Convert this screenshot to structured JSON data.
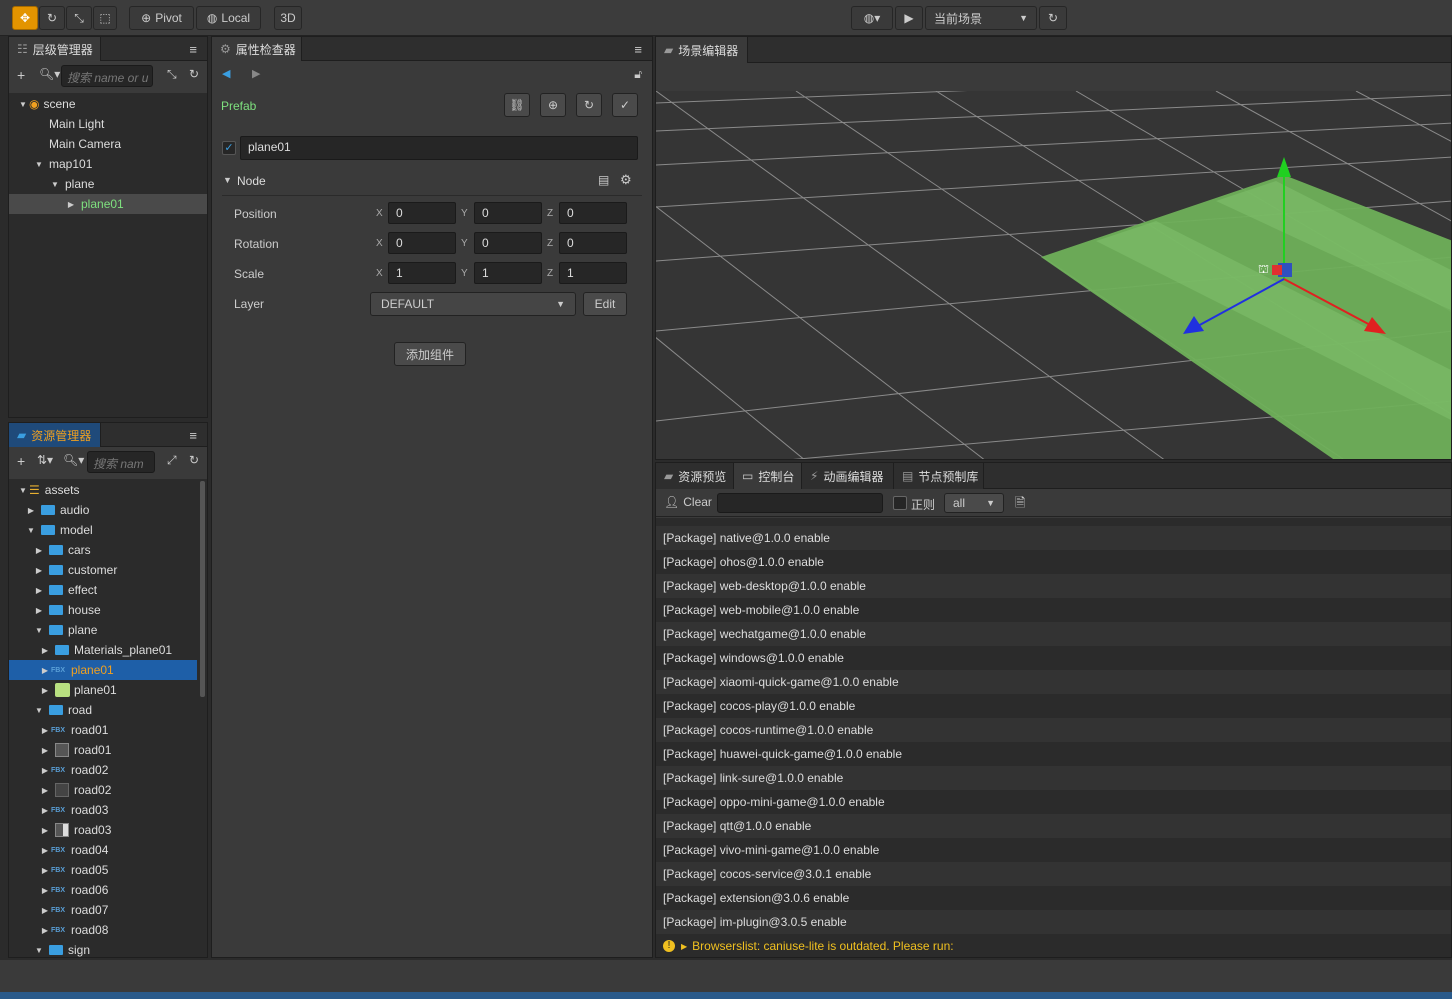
{
  "toolbar": {
    "pivot_label": "Pivot",
    "local_label": "Local",
    "mode_label": "3D",
    "scene_select": "当前场景"
  },
  "hierarchy": {
    "title": "层级管理器",
    "search_placeholder": "搜索 name or u",
    "nodes": [
      {
        "label": "scene",
        "depth": 0
      },
      {
        "label": "Main Light",
        "depth": 1
      },
      {
        "label": "Main Camera",
        "depth": 1
      },
      {
        "label": "map101",
        "depth": 1
      },
      {
        "label": "plane",
        "depth": 2
      },
      {
        "label": "plane01",
        "depth": 3,
        "selected": true
      }
    ]
  },
  "assets": {
    "title": "资源管理器",
    "search_placeholder": "搜索 nam",
    "items": [
      {
        "label": "assets",
        "type": "db"
      },
      {
        "label": "audio",
        "type": "folder"
      },
      {
        "label": "model",
        "type": "folder"
      },
      {
        "label": "cars",
        "type": "folder"
      },
      {
        "label": "customer",
        "type": "folder"
      },
      {
        "label": "effect",
        "type": "folder"
      },
      {
        "label": "house",
        "type": "folder"
      },
      {
        "label": "plane",
        "type": "folder"
      },
      {
        "label": "Materials_plane01",
        "type": "folder"
      },
      {
        "label": "plane01",
        "type": "fbx",
        "selected": true
      },
      {
        "label": "plane01",
        "type": "prefab"
      },
      {
        "label": "road",
        "type": "folder"
      },
      {
        "label": "road01",
        "type": "fbx"
      },
      {
        "label": "road01",
        "type": "prefab"
      },
      {
        "label": "road02",
        "type": "fbx"
      },
      {
        "label": "road02",
        "type": "prefab"
      },
      {
        "label": "road03",
        "type": "fbx"
      },
      {
        "label": "road03",
        "type": "prefab"
      },
      {
        "label": "road04",
        "type": "fbx"
      },
      {
        "label": "road05",
        "type": "fbx"
      },
      {
        "label": "road06",
        "type": "fbx"
      },
      {
        "label": "road07",
        "type": "fbx"
      },
      {
        "label": "road08",
        "type": "fbx"
      },
      {
        "label": "sign",
        "type": "folder"
      }
    ]
  },
  "inspector": {
    "title": "属性检查器",
    "prefab_label": "Prefab",
    "node_name": "plane01",
    "section": "Node",
    "position_label": "Position",
    "rotation_label": "Rotation",
    "scale_label": "Scale",
    "layer_label": "Layer",
    "x": "X",
    "y": "Y",
    "z": "Z",
    "position": [
      "0",
      "0",
      "0"
    ],
    "rotation": [
      "0",
      "0",
      "0"
    ],
    "scale": [
      "1",
      "1",
      "1"
    ],
    "layer_value": "DEFAULT",
    "edit_label": "Edit",
    "add_component": "添加组件"
  },
  "scene_editor": {
    "title": "场景编辑器"
  },
  "console": {
    "tabs": [
      "资源预览",
      "控制台",
      "动画编辑器",
      "节点预制库"
    ],
    "clear_label": "Clear",
    "regex_label": "正则",
    "filter_value": "all",
    "logs": [
      "[Package] native@1.0.0 enable",
      "[Package] ohos@1.0.0 enable",
      "[Package] web-desktop@1.0.0 enable",
      "[Package] web-mobile@1.0.0 enable",
      "[Package] wechatgame@1.0.0 enable",
      "[Package] windows@1.0.0 enable",
      "[Package] xiaomi-quick-game@1.0.0 enable",
      "[Package] cocos-play@1.0.0 enable",
      "[Package] cocos-runtime@1.0.0 enable",
      "[Package] huawei-quick-game@1.0.0 enable",
      "[Package] link-sure@1.0.0 enable",
      "[Package] oppo-mini-game@1.0.0 enable",
      "[Package] qtt@1.0.0 enable",
      "[Package] vivo-mini-game@1.0.0 enable",
      "[Package] cocos-service@3.0.1 enable",
      "[Package] extension@3.0.6 enable",
      "[Package] im-plugin@3.0.5 enable"
    ],
    "warning": "Browserslist: caniuse-lite is outdated. Please run:"
  }
}
